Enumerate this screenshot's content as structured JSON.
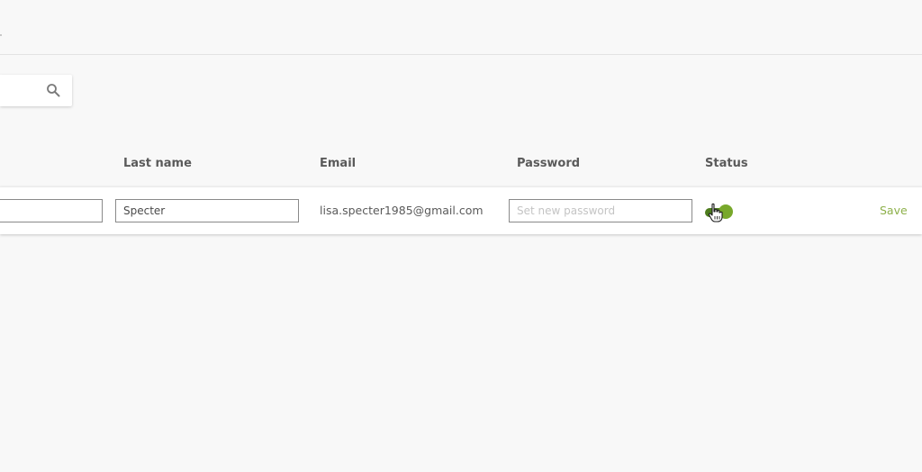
{
  "search": {
    "value": "",
    "icon": "search-icon"
  },
  "table": {
    "columns": {
      "last_name": "Last name",
      "email": "Email",
      "password": "Password",
      "status": "Status"
    },
    "row": {
      "first_name": "",
      "last_name": "Specter",
      "email": "lisa.specter1985@gmail.com",
      "password_placeholder": "Set new password",
      "status_active": true,
      "save_label": "Save"
    }
  },
  "colors": {
    "accent": "#78a82b",
    "accent_dark": "#4e7d1e",
    "save_link": "#8db04a",
    "background": "#f8f8f8"
  }
}
